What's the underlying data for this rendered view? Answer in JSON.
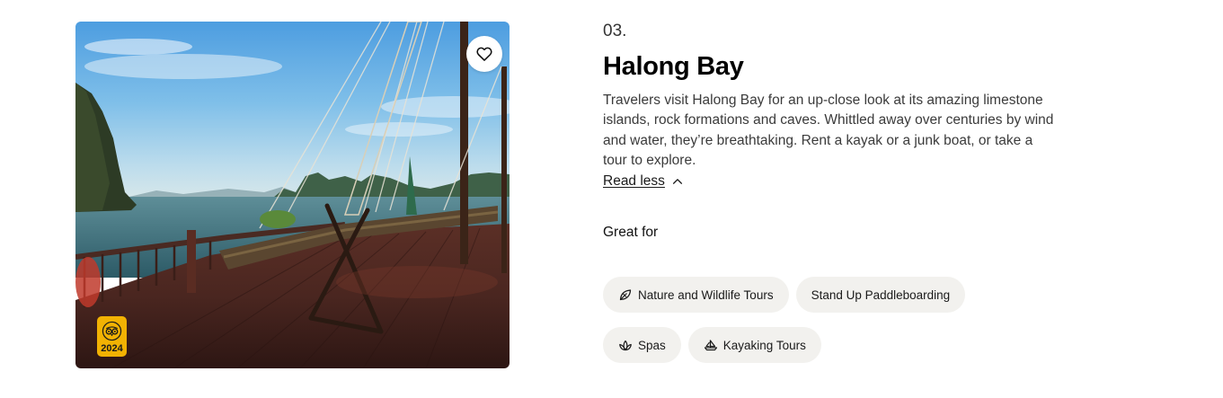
{
  "item": {
    "number": "03.",
    "title": "Halong Bay",
    "description": "Travelers visit Halong Bay for an up-close look at its amazing limestone islands, rock formations and caves. Whittled away over centuries by wind and water, they’re breathtaking. Rent a kayak or a junk boat, or take a tour to explore.",
    "read_less_label": "Read less",
    "photo_alt": "Halong Bay",
    "save_icon": "heart-icon",
    "award": {
      "year": "2024",
      "icon": "owl-award-icon",
      "color": "#f2b203"
    }
  },
  "great_for": {
    "heading": "Great for",
    "tags": [
      {
        "label": "Nature and Wildlife Tours",
        "icon": "leaf-icon"
      },
      {
        "label": "Stand Up Paddleboarding",
        "icon": ""
      },
      {
        "label": "Spas",
        "icon": "lotus-icon"
      },
      {
        "label": "Kayaking Tours",
        "icon": "boat-icon"
      }
    ]
  }
}
